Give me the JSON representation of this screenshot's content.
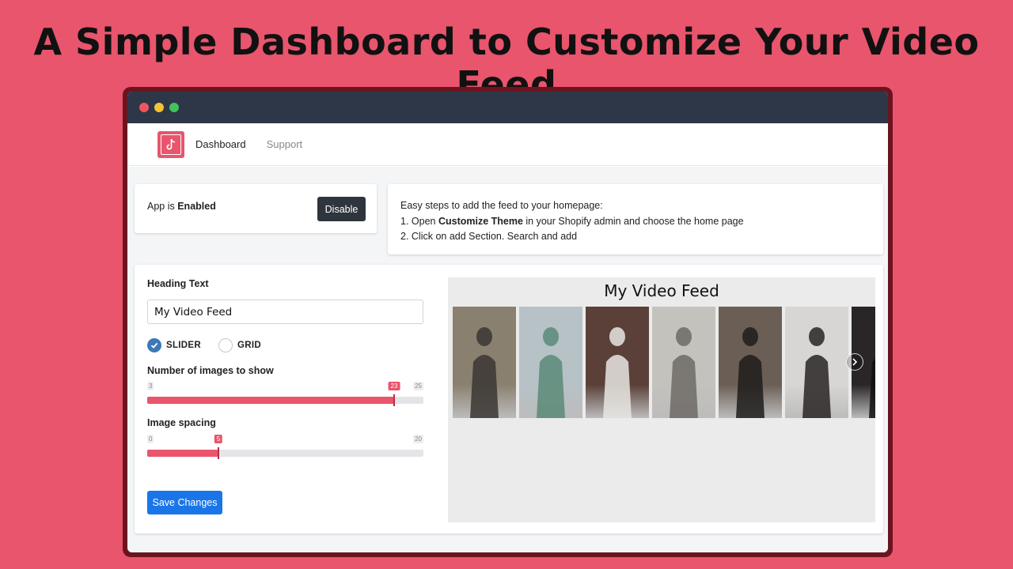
{
  "hero": {
    "title": "A Simple Dashboard to Customize Your Video Feed"
  },
  "nav": {
    "items": [
      {
        "label": "Dashboard"
      },
      {
        "label": "Support"
      }
    ]
  },
  "status": {
    "prefix": "App is ",
    "state": "Enabled",
    "button_label": "Disable"
  },
  "steps": {
    "intro": "Easy steps to add the feed to your homepage:",
    "step1_prefix": "1. Open ",
    "step1_bold": "Customize Theme",
    "step1_suffix": " in your Shopify admin and choose the home page",
    "step2": "2. Click on add Section. Search and add"
  },
  "form": {
    "heading_label": "Heading Text",
    "heading_value": "My Video Feed",
    "layout_options": [
      {
        "label": "SLIDER",
        "checked": true
      },
      {
        "label": "GRID",
        "checked": false
      }
    ],
    "images_label": "Number of images to show",
    "images_slider": {
      "min": "3",
      "max": "25",
      "value": "23"
    },
    "spacing_label": "Image spacing",
    "spacing_slider": {
      "min": "0",
      "max": "20",
      "value": "5"
    },
    "save_label": "Save Changes"
  },
  "preview": {
    "title": "My Video Feed",
    "thumbnails": [
      {
        "bg": "#8a8070",
        "fig": "#3a3632"
      },
      {
        "bg": "#b7c2c6",
        "fig": "#5a8a78"
      },
      {
        "bg": "#5a4038",
        "fig": "#e8e6e2"
      },
      {
        "bg": "#c4c2bc",
        "fig": "#6f6a66"
      },
      {
        "bg": "#6b5f55",
        "fig": "#1e1c1c"
      },
      {
        "bg": "#d8d6d4",
        "fig": "#2a2424"
      },
      {
        "bg": "#2a2628",
        "fig": "#101010"
      }
    ]
  },
  "colors": {
    "accent": "#e8556c",
    "primary_button": "#1a76e8",
    "dark_button": "#2f353d",
    "titlebar": "#2d3748"
  }
}
